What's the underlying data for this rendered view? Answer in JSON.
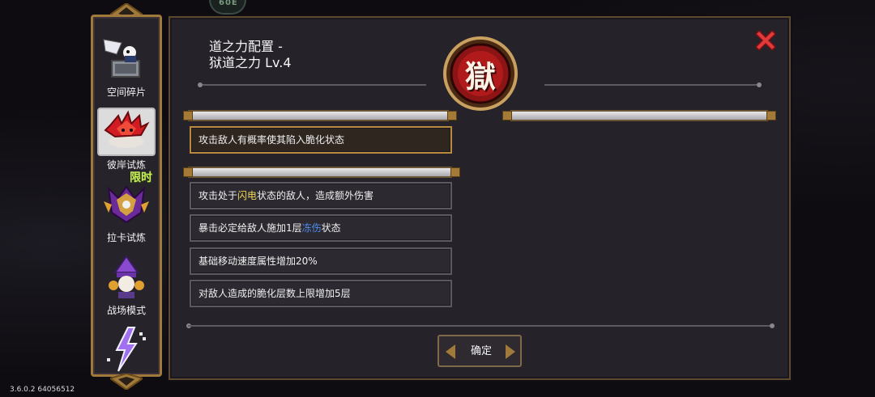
{
  "version_text": "3.6.0.2 64056512",
  "top_badge": "60E",
  "sidebar": {
    "items": [
      {
        "label": "空间碎片",
        "icon": "space-fragment-icon"
      },
      {
        "label": "彼岸试炼",
        "icon": "red-flower-icon"
      },
      {
        "label": "拉卡试炼",
        "icon": "lakka-trial-icon",
        "tag": "限时"
      },
      {
        "label": "战场模式",
        "icon": "battlefield-mage-icon"
      },
      {
        "label": "",
        "icon": "lightning-icon"
      }
    ]
  },
  "panel": {
    "title_line1": "道之力配置 -",
    "title_line2": "狱道之力 Lv.4",
    "emblem_char": "獄",
    "effects": [
      {
        "text": "攻击敌人有概率使其陷入脆化状态",
        "selected": true
      },
      {
        "prefix": "攻击处于",
        "highlight": "闪电",
        "suffix": "状态的敌人，造成额外伤害"
      },
      {
        "prefix": "暴击必定给敌人施加1层",
        "highlight": "冻伤",
        "suffix": "状态"
      },
      {
        "text": "基础移动速度属性增加20%"
      },
      {
        "text": "对敌人造成的脆化层数上限增加5层"
      }
    ],
    "confirm_label": "确定"
  },
  "colors": {
    "panel_bg": "#26222a",
    "gold_border": "#a07a3a",
    "lightning_highlight": "#f0d65a",
    "frost_highlight": "#4f8df0",
    "close_red": "#e03a3a",
    "emblem_red": "#8c1414"
  }
}
